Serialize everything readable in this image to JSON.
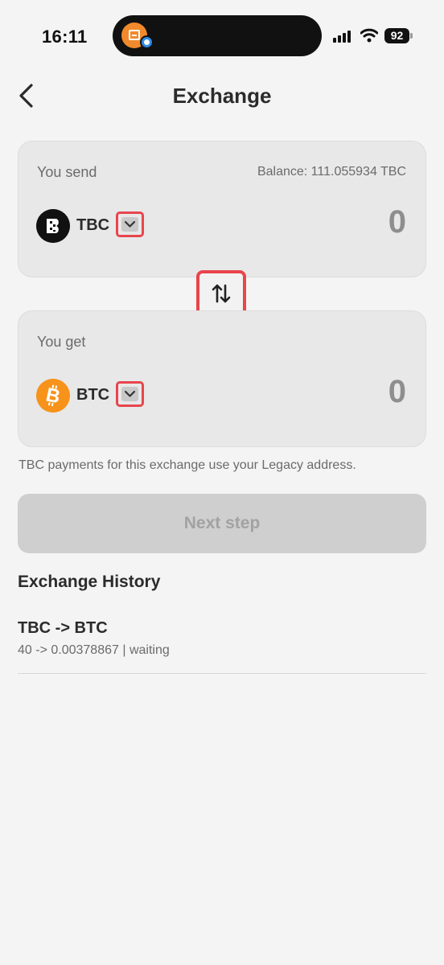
{
  "status_bar": {
    "time": "16:11",
    "battery": "92",
    "icons": [
      "app-notification-icon",
      "signal-icon",
      "wifi-icon",
      "battery-icon"
    ]
  },
  "header": {
    "title": "Exchange",
    "back_icon": "chevron-left-icon"
  },
  "send": {
    "label": "You send",
    "balance": "Balance: 111.055934 TBC",
    "coin": "TBC",
    "coin_icon": "tbc-coin-icon",
    "amount": "0"
  },
  "swap": {
    "icon": "swap-arrows-icon"
  },
  "get": {
    "label": "You get",
    "coin": "BTC",
    "coin_icon": "btc-coin-icon",
    "amount": "0"
  },
  "notice": "TBC payments for this exchange use your Legacy address.",
  "next_button": "Next step",
  "history": {
    "heading": "Exchange History",
    "items": [
      {
        "pair": "TBC -> BTC",
        "detail": "40 -> 0.00378867 | waiting"
      }
    ]
  },
  "colors": {
    "background": "#f4f4f4",
    "card": "#e8e8e8",
    "highlight": "#e8454d",
    "btc": "#f7931a",
    "disabled_button": "#cfcfcf"
  }
}
